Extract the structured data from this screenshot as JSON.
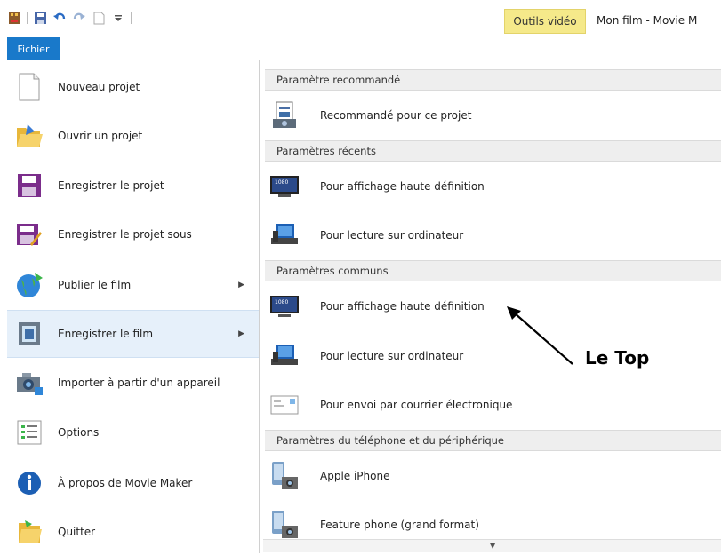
{
  "window": {
    "contextual_tab": "Outils vidéo",
    "title": "Mon film - Movie M"
  },
  "quick_access": {
    "icons": [
      "app-icon",
      "save-icon",
      "undo-icon",
      "redo-icon",
      "new-icon",
      "customize-dropdown-icon"
    ]
  },
  "ribbon": {
    "file_tab": "Fichier"
  },
  "menu": {
    "items": [
      {
        "label": "Nouveau projet",
        "icon": "new-project-icon"
      },
      {
        "label": "Ouvrir un projet",
        "icon": "open-folder-icon"
      },
      {
        "label": "Enregistrer le projet",
        "icon": "save-project-icon"
      },
      {
        "label": "Enregistrer le projet sous",
        "icon": "save-as-icon"
      },
      {
        "label": "Publier le film",
        "icon": "publish-globe-icon",
        "submenu": true
      },
      {
        "label": "Enregistrer le film",
        "icon": "save-movie-icon",
        "submenu": true,
        "selected": true
      },
      {
        "label": "Importer à partir d'un appareil",
        "icon": "import-camera-icon"
      },
      {
        "label": "Options",
        "icon": "options-icon"
      },
      {
        "label": "À propos de Movie Maker",
        "icon": "info-icon"
      },
      {
        "label": "Quitter",
        "icon": "exit-icon"
      }
    ]
  },
  "panel": {
    "sections": [
      {
        "title": "Paramètre recommandé",
        "options": [
          {
            "label": "Recommandé pour ce projet",
            "icon": "recommended-icon"
          }
        ]
      },
      {
        "title": "Paramètres récents",
        "options": [
          {
            "label": "Pour affichage haute définition",
            "icon": "hd-display-icon"
          },
          {
            "label": "Pour lecture sur ordinateur",
            "icon": "computer-icon"
          }
        ]
      },
      {
        "title": "Paramètres communs",
        "options": [
          {
            "label": "Pour affichage haute définition",
            "icon": "hd-display-icon"
          },
          {
            "label": "Pour lecture sur ordinateur",
            "icon": "computer-icon"
          },
          {
            "label": "Pour envoi par courrier électronique",
            "icon": "email-icon"
          }
        ]
      },
      {
        "title": "Paramètres du téléphone et du périphérique",
        "options": [
          {
            "label": "Apple iPhone",
            "icon": "phone-camera-icon"
          },
          {
            "label": "Feature phone (grand format)",
            "icon": "phone-camera-icon"
          }
        ]
      }
    ]
  },
  "annotation": {
    "text": "Le Top"
  },
  "colors": {
    "file_tab": "#1979ca",
    "contextual_tab": "#f5e98a",
    "selected_item": "#e6f0fa",
    "section_header": "#eeeeee"
  }
}
